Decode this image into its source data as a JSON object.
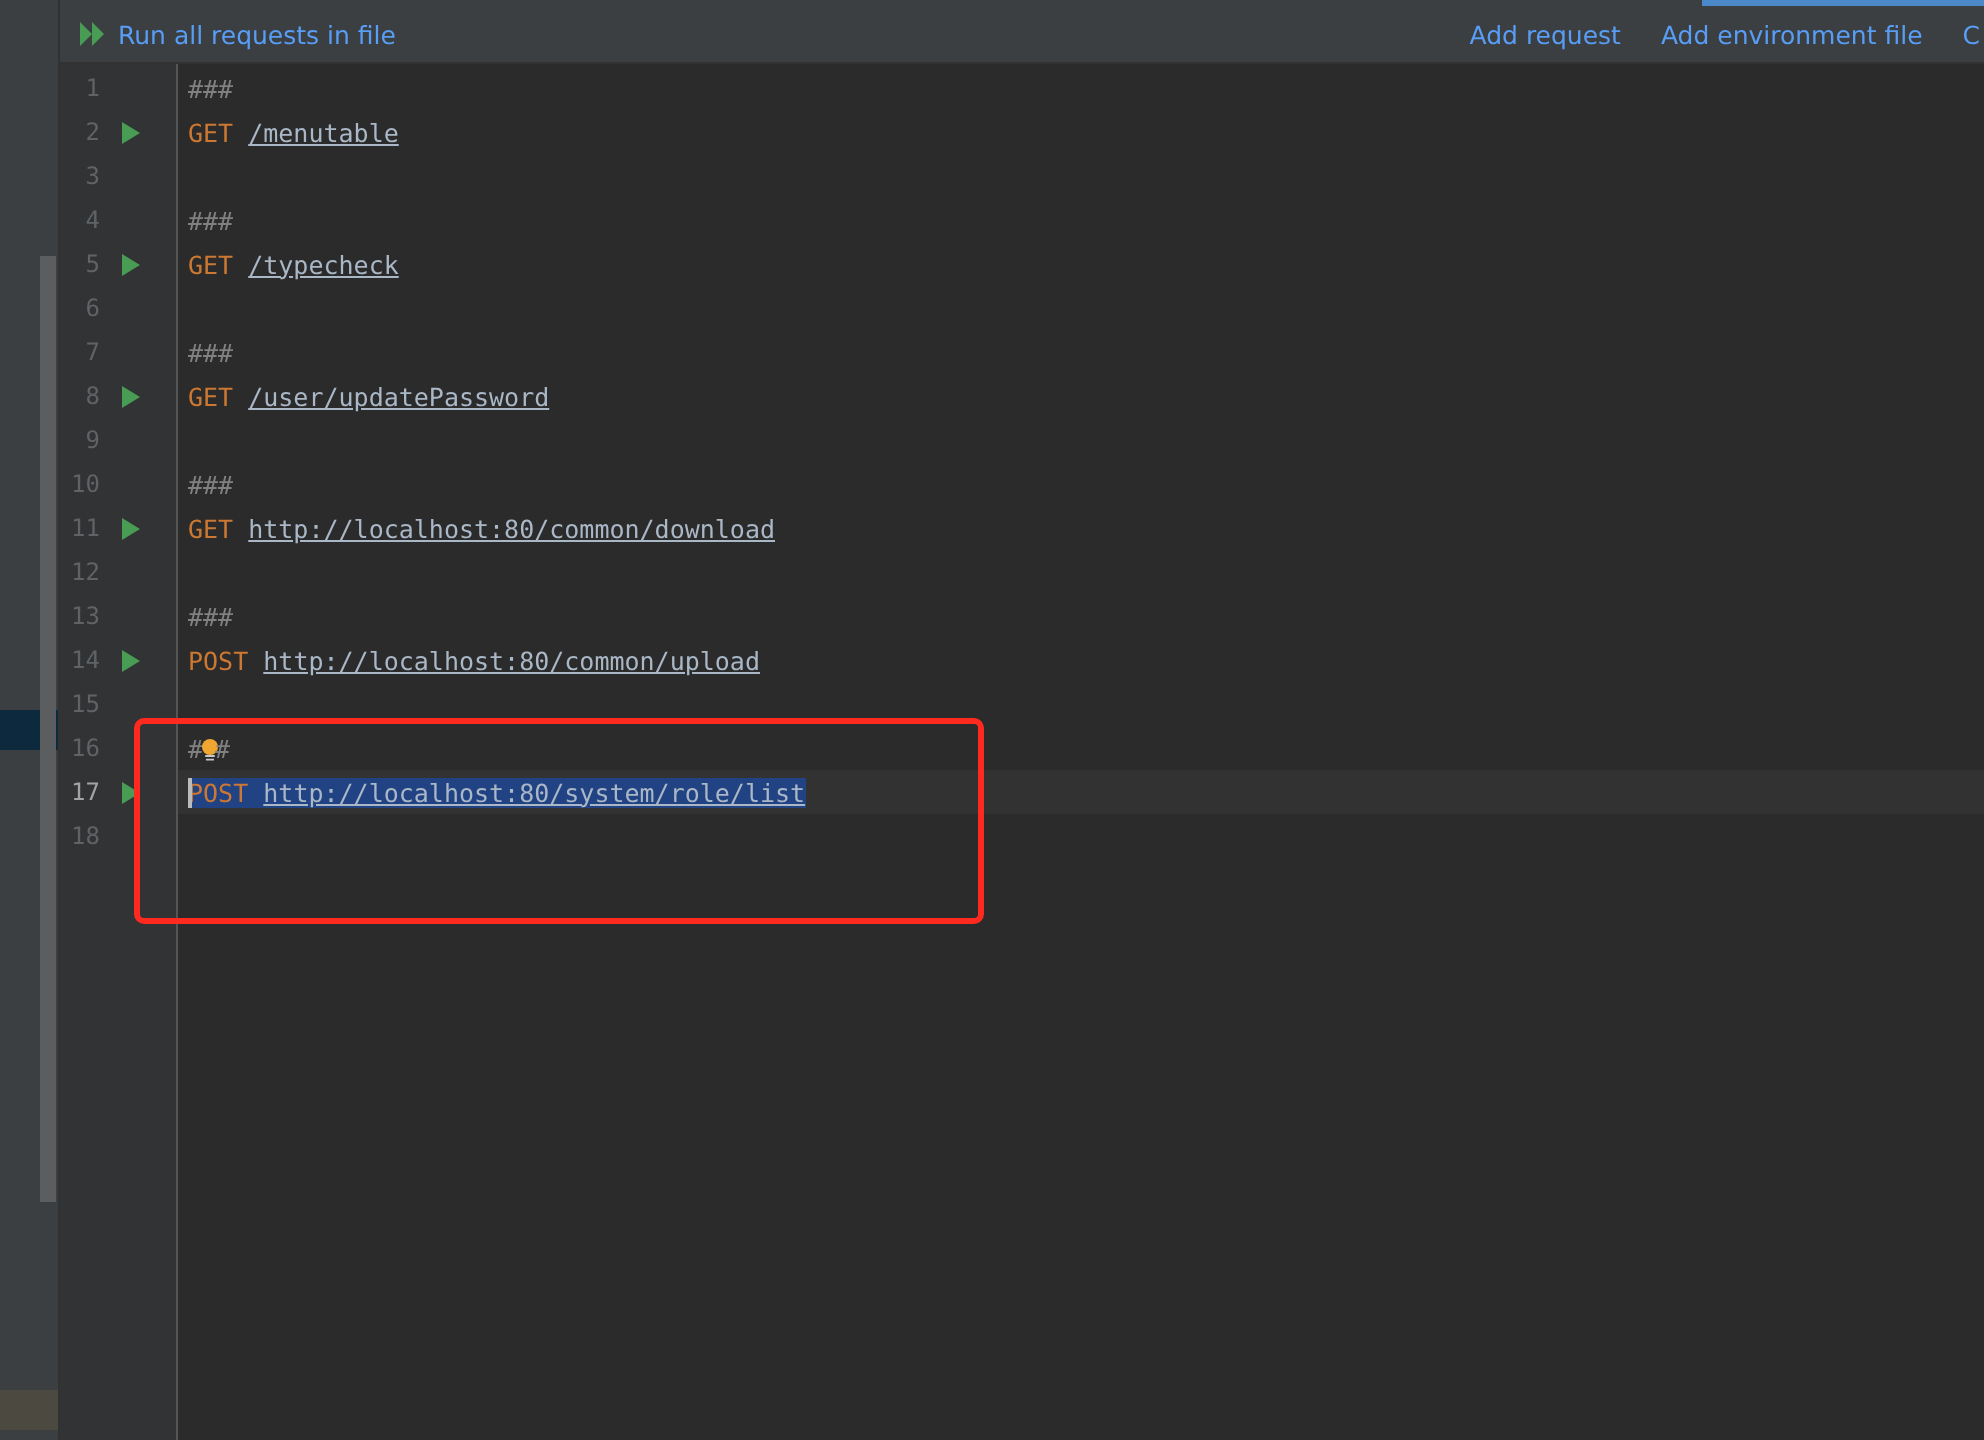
{
  "toolbar": {
    "run_all": "Run all requests in file",
    "links": [
      "Add request",
      "Add environment file",
      "C"
    ]
  },
  "editor": {
    "lines": [
      {
        "number": "1",
        "kind": "separator",
        "text": "###"
      },
      {
        "number": "2",
        "kind": "request",
        "method": "GET",
        "url": "/menutable",
        "selected": false
      },
      {
        "number": "3",
        "kind": "blank"
      },
      {
        "number": "4",
        "kind": "separator",
        "text": "###"
      },
      {
        "number": "5",
        "kind": "request",
        "method": "GET",
        "url": "/typecheck",
        "selected": false
      },
      {
        "number": "6",
        "kind": "blank"
      },
      {
        "number": "7",
        "kind": "separator",
        "text": "###"
      },
      {
        "number": "8",
        "kind": "request",
        "method": "GET",
        "url": "/user/updatePassword",
        "selected": false
      },
      {
        "number": "9",
        "kind": "blank"
      },
      {
        "number": "10",
        "kind": "separator",
        "text": "###"
      },
      {
        "number": "11",
        "kind": "request",
        "method": "GET",
        "url": "http://localhost:80/common/download",
        "selected": false
      },
      {
        "number": "12",
        "kind": "blank"
      },
      {
        "number": "13",
        "kind": "separator",
        "text": "###"
      },
      {
        "number": "14",
        "kind": "request",
        "method": "POST",
        "url": "http://localhost:80/common/upload",
        "selected": false
      },
      {
        "number": "15",
        "kind": "blank"
      },
      {
        "number": "16",
        "kind": "separator_bulb",
        "text_before": "#",
        "text_after": "#"
      },
      {
        "number": "17",
        "kind": "request",
        "method": "POST",
        "url": "http://localhost:80/system/role/list",
        "selected": true
      },
      {
        "number": "18",
        "kind": "blank"
      }
    ]
  }
}
